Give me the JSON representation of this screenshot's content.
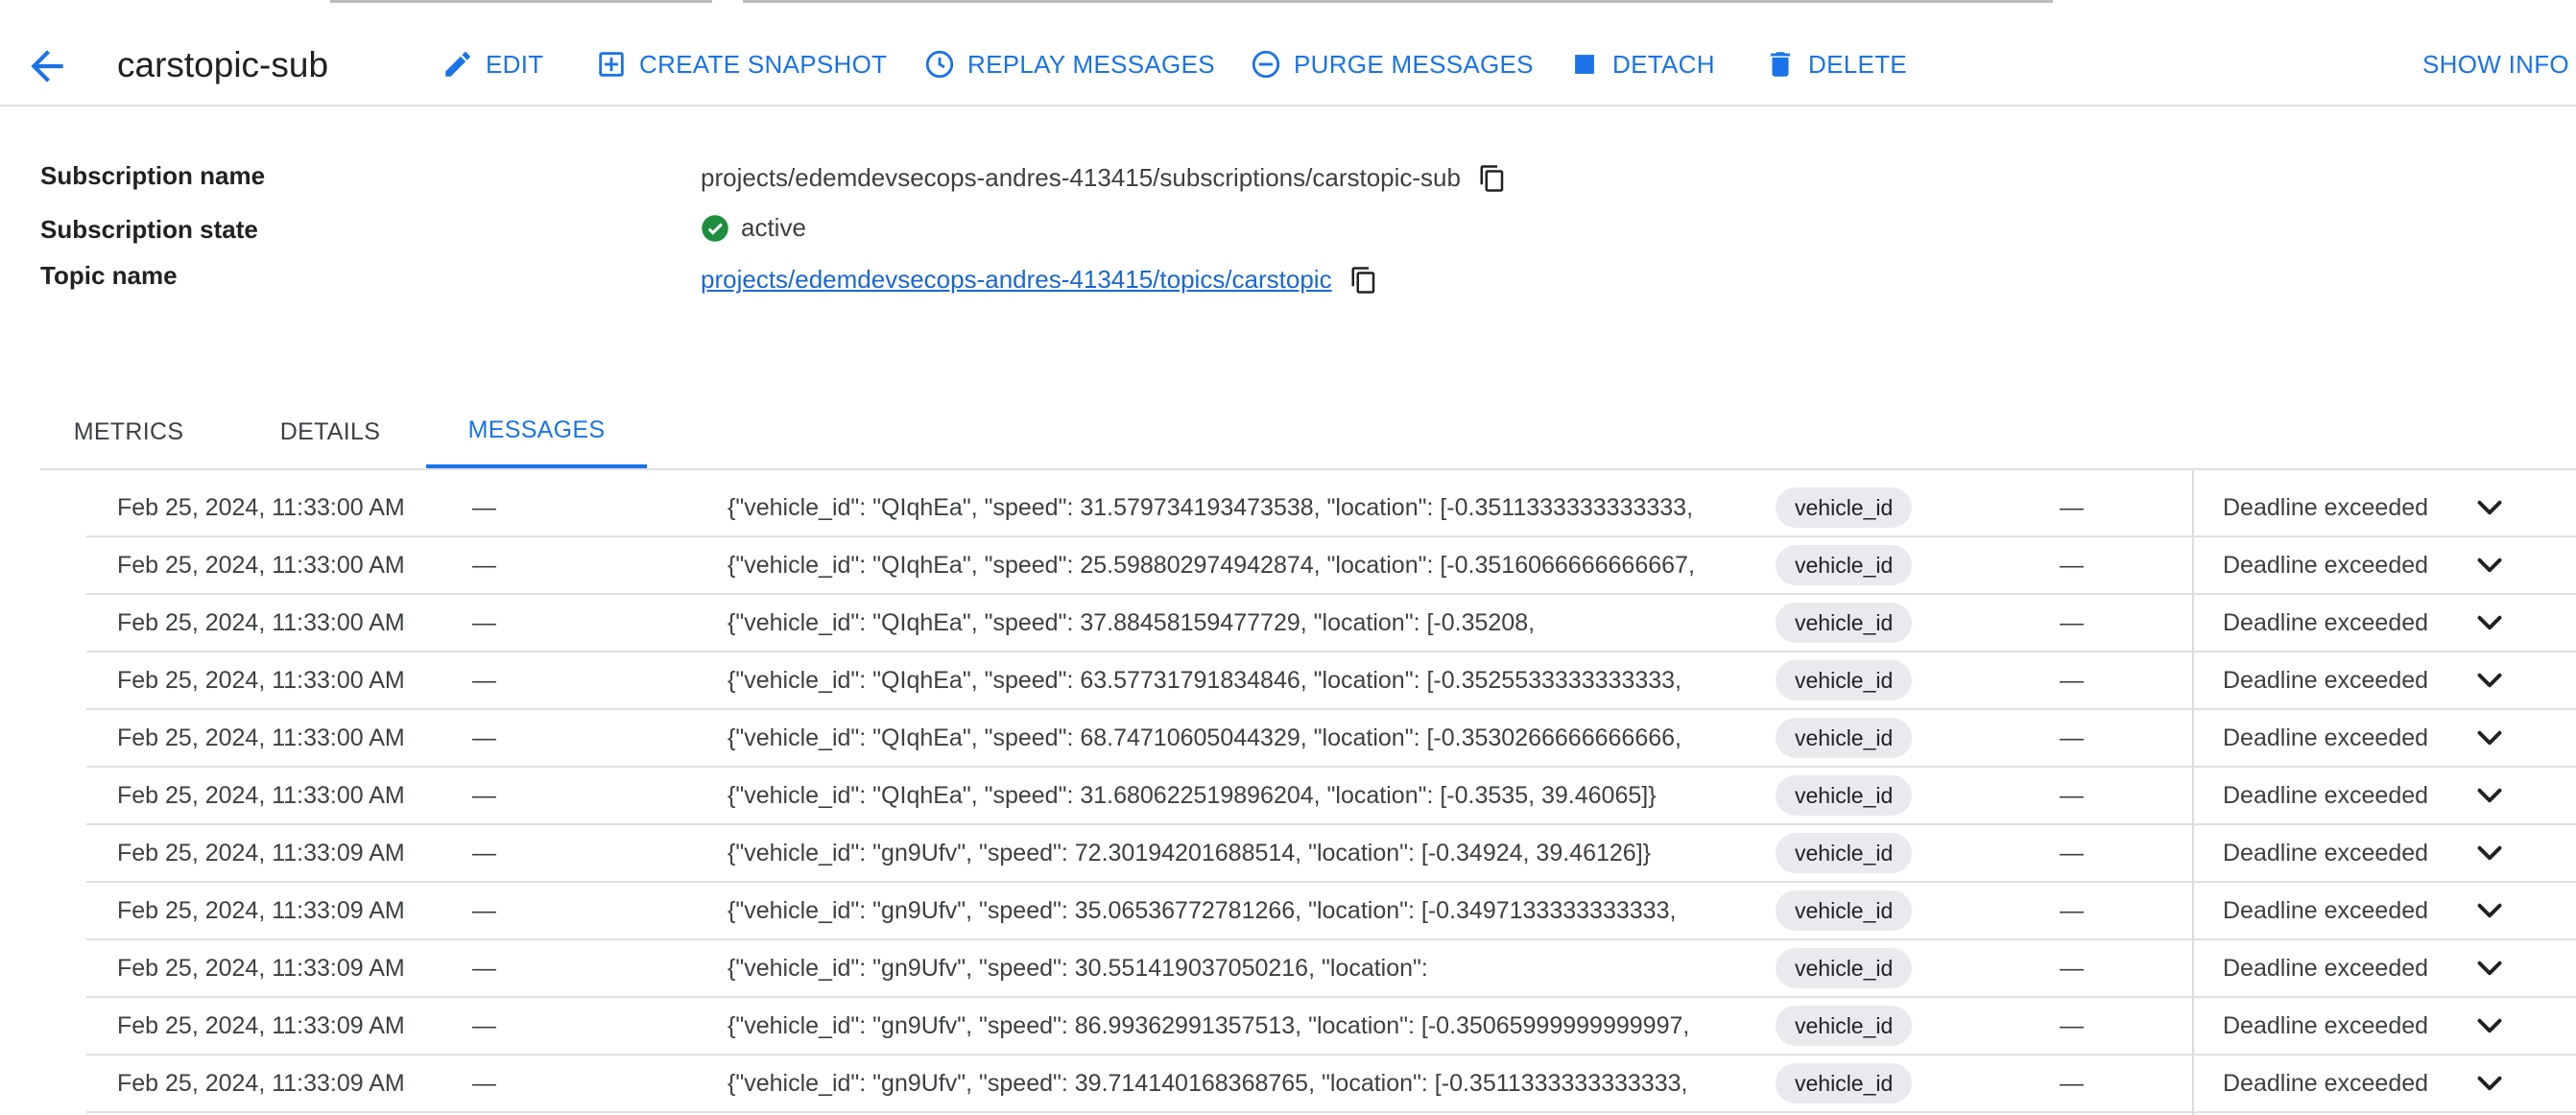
{
  "header": {
    "title": "carstopic-sub",
    "actions": {
      "edit": "EDIT",
      "snapshot": "CREATE SNAPSHOT",
      "replay": "REPLAY MESSAGES",
      "purge": "PURGE MESSAGES",
      "detach": "DETACH",
      "delete": "DELETE",
      "show_info": "SHOW INFO P"
    }
  },
  "details": {
    "subscription_name_label": "Subscription name",
    "subscription_name_value": "projects/edemdevsecops-andres-413415/subscriptions/carstopic-sub",
    "subscription_state_label": "Subscription state",
    "subscription_state_value": "active",
    "topic_name_label": "Topic name",
    "topic_name_value": "projects/edemdevsecops-andres-413415/topics/carstopic"
  },
  "tabs": [
    "METRICS",
    "DETAILS",
    "MESSAGES"
  ],
  "active_tab": "MESSAGES",
  "messages": [
    {
      "time": "Feb 25, 2024, 11:33:00 AM",
      "dash1": "—",
      "body": "{\"vehicle_id\": \"QIqhEa\", \"speed\": 31.579734193473538, \"location\": [-0.3511333333333333,",
      "attr": "vehicle_id",
      "dash2": "—",
      "status": "Deadline exceeded"
    },
    {
      "time": "Feb 25, 2024, 11:33:00 AM",
      "dash1": "—",
      "body": "{\"vehicle_id\": \"QIqhEa\", \"speed\": 25.598802974942874, \"location\": [-0.3516066666666667,",
      "attr": "vehicle_id",
      "dash2": "—",
      "status": "Deadline exceeded"
    },
    {
      "time": "Feb 25, 2024, 11:33:00 AM",
      "dash1": "—",
      "body": "{\"vehicle_id\": \"QIqhEa\", \"speed\": 37.88458159477729, \"location\": [-0.35208,",
      "attr": "vehicle_id",
      "dash2": "—",
      "status": "Deadline exceeded"
    },
    {
      "time": "Feb 25, 2024, 11:33:00 AM",
      "dash1": "—",
      "body": "{\"vehicle_id\": \"QIqhEa\", \"speed\": 63.57731791834846, \"location\": [-0.3525533333333333,",
      "attr": "vehicle_id",
      "dash2": "—",
      "status": "Deadline exceeded"
    },
    {
      "time": "Feb 25, 2024, 11:33:00 AM",
      "dash1": "—",
      "body": "{\"vehicle_id\": \"QIqhEa\", \"speed\": 68.74710605044329, \"location\": [-0.3530266666666666,",
      "attr": "vehicle_id",
      "dash2": "—",
      "status": "Deadline exceeded"
    },
    {
      "time": "Feb 25, 2024, 11:33:00 AM",
      "dash1": "—",
      "body": "{\"vehicle_id\": \"QIqhEa\", \"speed\": 31.680622519896204, \"location\": [-0.3535, 39.46065]}",
      "attr": "vehicle_id",
      "dash2": "—",
      "status": "Deadline exceeded"
    },
    {
      "time": "Feb 25, 2024, 11:33:09 AM",
      "dash1": "—",
      "body": "{\"vehicle_id\": \"gn9Ufv\", \"speed\": 72.30194201688514, \"location\": [-0.34924, 39.46126]}",
      "attr": "vehicle_id",
      "dash2": "—",
      "status": "Deadline exceeded"
    },
    {
      "time": "Feb 25, 2024, 11:33:09 AM",
      "dash1": "—",
      "body": "{\"vehicle_id\": \"gn9Ufv\", \"speed\": 35.06536772781266, \"location\": [-0.3497133333333333,",
      "attr": "vehicle_id",
      "dash2": "—",
      "status": "Deadline exceeded"
    },
    {
      "time": "Feb 25, 2024, 11:33:09 AM",
      "dash1": "—",
      "body": "{\"vehicle_id\": \"gn9Ufv\", \"speed\": 30.551419037050216, \"location\":",
      "attr": "vehicle_id",
      "dash2": "—",
      "status": "Deadline exceeded"
    },
    {
      "time": "Feb 25, 2024, 11:33:09 AM",
      "dash1": "—",
      "body": "{\"vehicle_id\": \"gn9Ufv\", \"speed\": 86.99362991357513, \"location\": [-0.35065999999999997,",
      "attr": "vehicle_id",
      "dash2": "—",
      "status": "Deadline exceeded"
    },
    {
      "time": "Feb 25, 2024, 11:33:09 AM",
      "dash1": "—",
      "body": "{\"vehicle_id\": \"gn9Ufv\", \"speed\": 39.714140168368765, \"location\": [-0.3511333333333333,",
      "attr": "vehicle_id",
      "dash2": "—",
      "status": "Deadline exceeded"
    }
  ],
  "colors": {
    "accent": "#1a73e8",
    "success": "#1e8e3e",
    "chip_bg": "#e8eaed"
  }
}
